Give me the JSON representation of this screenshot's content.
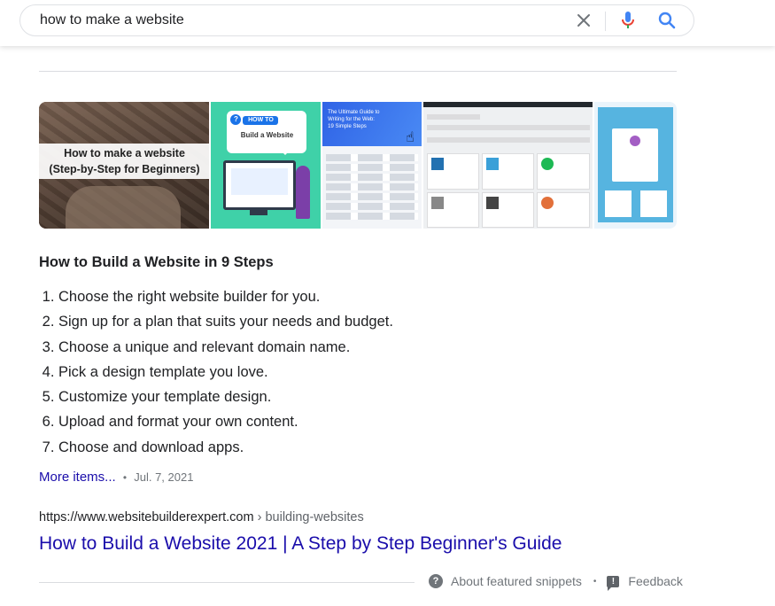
{
  "search": {
    "query": "how to make a website"
  },
  "images": [
    {
      "caption_line1": "How to make a website",
      "caption_line2": "(Step-by-Step for Beginners)"
    },
    {
      "badge": "HOW TO",
      "text": "Build a Website"
    },
    {
      "banner_text": "The Ultimate Guide to Writing for the Web: 19 Simple Steps"
    },
    {},
    {}
  ],
  "snippet": {
    "title": "How to Build a Website in 9 Steps",
    "steps": [
      "Choose the right website builder for you.",
      "Sign up for a plan that suits your needs and budget.",
      "Choose a unique and relevant domain name.",
      "Pick a design template you love.",
      "Customize your template design.",
      "Upload and format your own content.",
      "Choose and download apps."
    ],
    "more_label": "More items...",
    "separator": "•",
    "date": "Jul. 7, 2021"
  },
  "result": {
    "url": "https://www.websitebuilderexpert.com",
    "breadcrumb": " › building-websites",
    "title": "How to Build a Website 2021 | A Step by Step Beginner's Guide"
  },
  "footer": {
    "about_label": "About featured snippets",
    "separator": "•",
    "feedback_label": "Feedback"
  },
  "colors": {
    "link": "#1a0dab",
    "mic_blue": "#4285f4",
    "mic_red": "#ea4335",
    "secondary_text": "#70757a"
  }
}
